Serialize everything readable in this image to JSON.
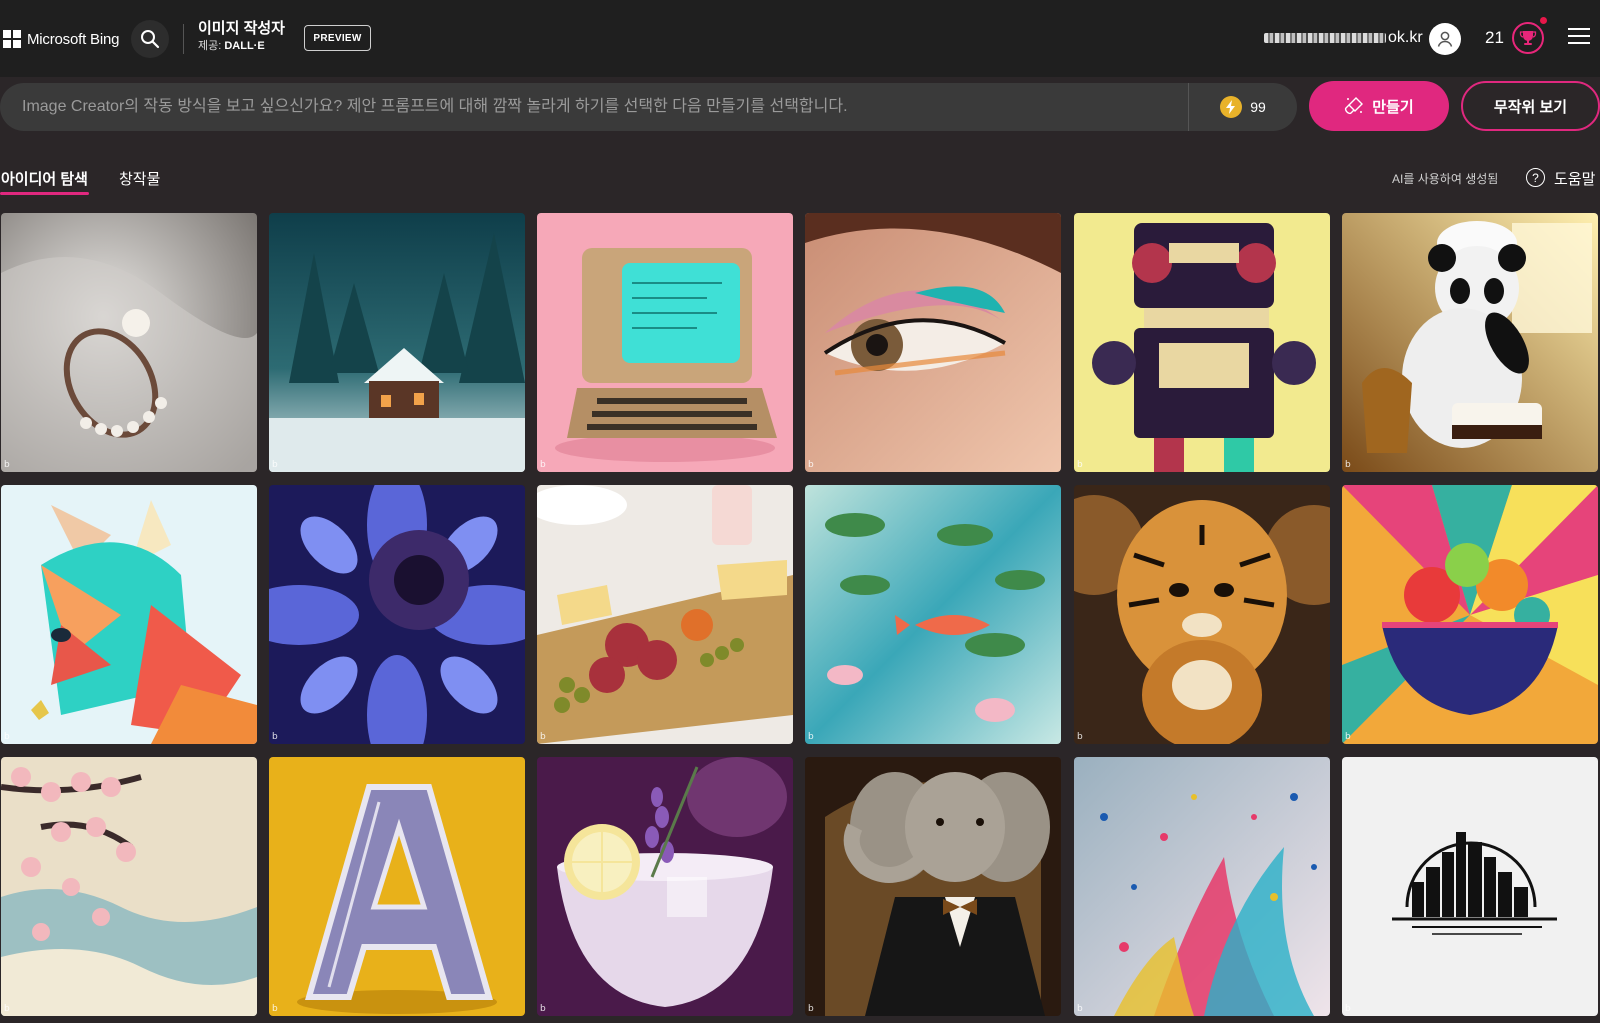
{
  "header": {
    "brand": "Microsoft Bing",
    "app_title": "이미지 작성자",
    "app_subtitle_prefix": "제공: ",
    "app_subtitle_provider": "DALL·E",
    "preview_badge": "PREVIEW",
    "user_email_visible": "ok.kr",
    "points": "21"
  },
  "prompt": {
    "placeholder": "Image Creator의 작동 방식을 보고 싶으신가요? 제안 프롬프트에 대해 깜짝 놀라게 하기를 선택한 다음 만들기를 선택합니다.",
    "boosts": "99",
    "create_label": "만들기",
    "surprise_label": "무작위 보기"
  },
  "tabs": {
    "explore": "아이디어 탐색",
    "creations": "창작물",
    "ai_note": "AI를 사용하여 생성됨",
    "help": "도움말"
  },
  "tile_mark": "b",
  "colors": {
    "accent": "#e0287f",
    "header_bg": "#1f1f1f",
    "page_bg": "#2b2628"
  }
}
